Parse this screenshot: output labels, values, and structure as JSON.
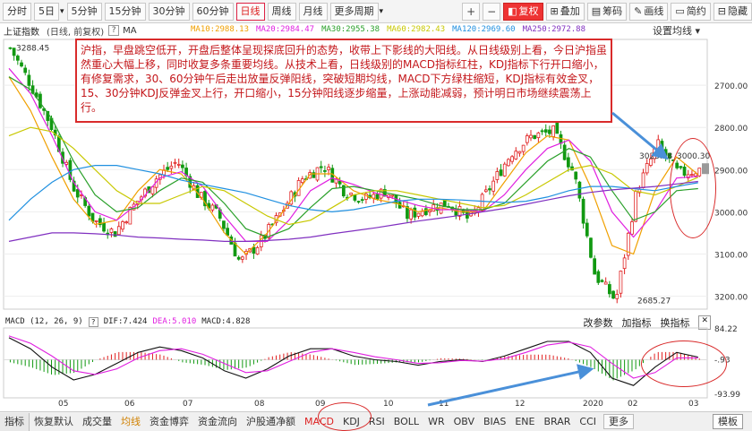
{
  "toolbar": {
    "periods": [
      "分时",
      "5日",
      "5分钟",
      "15分钟",
      "30分钟",
      "60分钟",
      "日线",
      "周线",
      "月线",
      "更多周期"
    ],
    "period_dropdowns": [
      false,
      true,
      false,
      false,
      false,
      false,
      false,
      false,
      false,
      true
    ],
    "active_period": "日线",
    "right_buttons": [
      "复权",
      "叠加",
      "筹码",
      "画线",
      "简约",
      "隐藏"
    ],
    "zoom_in": "+",
    "zoom_out": "−"
  },
  "info": {
    "title": "上证指数",
    "subtitle": "(日线, 前复权)",
    "help": "?",
    "ma_label": "MA",
    "settings": "设置均线"
  },
  "ma_values": [
    {
      "label": "MA10:2988.13",
      "color": "#f0a000"
    },
    {
      "label": "MA20:2984.47",
      "color": "#e020e0"
    },
    {
      "label": "MA30:2955.38",
      "color": "#2aa02a"
    },
    {
      "label": "MA60:2982.43",
      "color": "#c8c800"
    },
    {
      "label": "MA120:2969.60",
      "color": "#2090e0"
    },
    {
      "label": "MA250:2972.88",
      "color": "#8030c0"
    }
  ],
  "annotation": "沪指，早盘跳空低开，开盘后整体呈现探底回升的态势，收带上下影线的大阳线。从日线级别上看，今日沪指虽然重心大幅上移，同时收复多条重要均线。从技术上看，日线级别的MACD指标红柱，KDJ指标下行开口缩小，有修复需求，30、60分钟午后走出放量反弹阳线，突破短期均线，MACD下方绿柱缩短，KDJ指标有效金叉，15、30分钟KDJ反弹金叉上行，开口缩小，15分钟阳线逐步缩量，上涨动能减弱，预计明日市场继续震荡上行。",
  "price_labels": {
    "high": "3288.45",
    "low": "2685.27",
    "recent": "3023.28",
    "current": "3000.30"
  },
  "y_axis": [
    "3200.00",
    "3100.00",
    "3000.00",
    "2900.00",
    "2800.00",
    "2700.00"
  ],
  "macd": {
    "label": "MACD (12, 26, 9)",
    "dif": "DIF:7.424",
    "dea": "DEA:5.010",
    "macd": "MACD:4.828",
    "buttons": [
      "改参数",
      "加指标",
      "换指标"
    ],
    "y_axis": [
      "84.22",
      "-.93",
      "-93.99"
    ]
  },
  "x_axis": [
    "05",
    "06",
    "07",
    "08",
    "09",
    "10",
    "11",
    "12",
    "2020",
    "02",
    "03"
  ],
  "tabs": [
    "指标",
    "恢复默认",
    "成交量",
    "均线",
    "资金博弈",
    "资金流向",
    "沪股通净额",
    "MACD",
    "KDJ",
    "RSI",
    "BOLL",
    "WR",
    "OBV",
    "BIAS",
    "ENE",
    "BRAR",
    "CCI",
    "更多",
    "模板"
  ],
  "active_tab": "MACD",
  "colors": {
    "up": "#e02020",
    "down": "#119911",
    "dif": "#111111",
    "dea": "#e020e0",
    "accent": "#d92b2b"
  },
  "chart_data": {
    "type": "candlestick",
    "x_ticks": [
      "05",
      "06",
      "07",
      "08",
      "09",
      "10",
      "11",
      "12",
      "2020",
      "02",
      "03"
    ],
    "ylim": [
      2680,
      3300
    ],
    "y_ticks": [
      2700,
      2800,
      2900,
      3000,
      3100,
      3200
    ],
    "close_anchors": [
      3288,
      3200,
      3100,
      2960,
      2880,
      2850,
      2920,
      2980,
      3020,
      2940,
      2890,
      2780,
      2830,
      2900,
      2980,
      3010,
      2950,
      2930,
      2950,
      2890,
      2910,
      2920,
      2880,
      2960,
      3040,
      3080,
      3090,
      2990,
      2750,
      2690,
      2950,
      3060,
      2990,
      3000
    ],
    "series": [
      {
        "name": "MA10",
        "values": [
          3220,
          3140,
          3030,
          2930,
          2870,
          2880,
          2950,
          3000,
          2990,
          2930,
          2850,
          2800,
          2850,
          2920,
          2990,
          2990,
          2950,
          2930,
          2920,
          2900,
          2910,
          2900,
          2900,
          2970,
          3040,
          3080,
          3070,
          2960,
          2820,
          2800,
          2950,
          3030,
          2988
        ]
      },
      {
        "name": "MA20",
        "values": [
          3240,
          3180,
          3080,
          2970,
          2900,
          2880,
          2920,
          2980,
          2995,
          2960,
          2890,
          2830,
          2830,
          2880,
          2950,
          2980,
          2965,
          2945,
          2930,
          2915,
          2905,
          2905,
          2900,
          2940,
          3000,
          3050,
          3070,
          3020,
          2900,
          2840,
          2900,
          2980,
          2984
        ]
      },
      {
        "name": "MA30",
        "values": [
          3220,
          3190,
          3120,
          3020,
          2940,
          2900,
          2910,
          2950,
          2980,
          2970,
          2920,
          2860,
          2840,
          2860,
          2910,
          2955,
          2960,
          2950,
          2940,
          2930,
          2915,
          2905,
          2905,
          2920,
          2970,
          3020,
          3050,
          3030,
          2950,
          2880,
          2900,
          2950,
          2955
        ]
      },
      {
        "name": "MA60",
        "values": [
          3080,
          3100,
          3090,
          3050,
          3000,
          2950,
          2920,
          2920,
          2940,
          2960,
          2950,
          2920,
          2890,
          2870,
          2880,
          2910,
          2940,
          2950,
          2950,
          2940,
          2930,
          2920,
          2910,
          2915,
          2940,
          2970,
          3000,
          3010,
          2990,
          2950,
          2940,
          2960,
          2982
        ]
      },
      {
        "name": "MA120",
        "values": [
          2880,
          2930,
          2970,
          3000,
          3010,
          3010,
          3000,
          2990,
          2975,
          2965,
          2955,
          2945,
          2930,
          2915,
          2905,
          2900,
          2905,
          2915,
          2925,
          2930,
          2930,
          2928,
          2925,
          2922,
          2925,
          2935,
          2950,
          2960,
          2960,
          2955,
          2950,
          2960,
          2969
        ]
      },
      {
        "name": "MA250",
        "values": [
          2830,
          2840,
          2850,
          2850,
          2848,
          2845,
          2840,
          2838,
          2835,
          2833,
          2830,
          2830,
          2832,
          2835,
          2840,
          2848,
          2855,
          2862,
          2870,
          2878,
          2885,
          2892,
          2900,
          2908,
          2918,
          2928,
          2938,
          2946,
          2952,
          2956,
          2960,
          2966,
          2972
        ]
      }
    ],
    "macd": {
      "ylim": [
        -93.99,
        84.22
      ],
      "dif": [
        60,
        30,
        -20,
        -55,
        -40,
        -10,
        20,
        35,
        25,
        5,
        -30,
        -50,
        -25,
        10,
        30,
        30,
        10,
        0,
        -5,
        -15,
        -5,
        0,
        -5,
        10,
        30,
        50,
        50,
        20,
        -50,
        -70,
        -20,
        20,
        7.424
      ],
      "dea": [
        65,
        45,
        10,
        -30,
        -40,
        -25,
        5,
        25,
        30,
        15,
        -10,
        -35,
        -30,
        -5,
        20,
        30,
        20,
        8,
        0,
        -10,
        -8,
        -2,
        -4,
        3,
        20,
        40,
        48,
        35,
        -10,
        -50,
        -35,
        5,
        5.01
      ]
    }
  }
}
